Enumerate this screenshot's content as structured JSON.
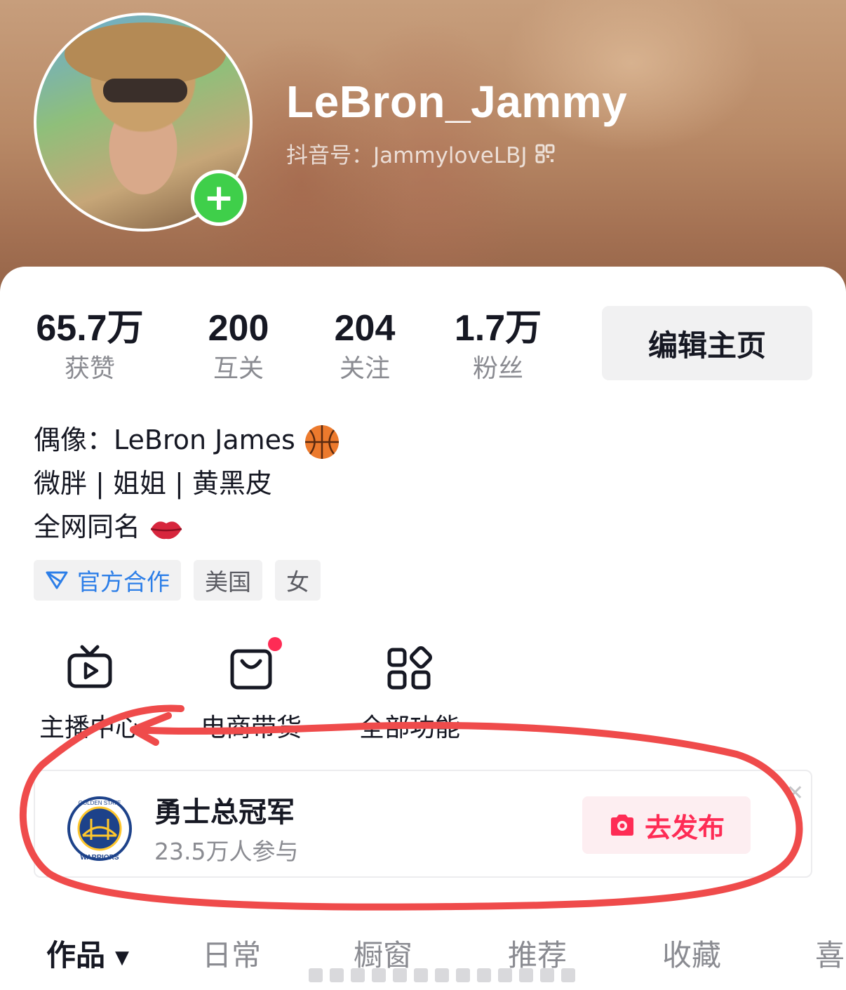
{
  "profile": {
    "username": "LeBron_Jammy",
    "douyin_id": "抖音号：JammyloveLBJ",
    "add_icon": "plus-icon",
    "qr_icon": "qr-code-icon"
  },
  "stats": [
    {
      "value": "65.7万",
      "label": "获赞"
    },
    {
      "value": "200",
      "label": "互关"
    },
    {
      "value": "204",
      "label": "关注"
    },
    {
      "value": "1.7万",
      "label": "粉丝"
    }
  ],
  "edit_button": "编辑主页",
  "bio": {
    "line1": "偶像：LeBron James",
    "line1_emoji": "basketball-icon",
    "line2": "微胖 | 姐姐 | 黄黑皮",
    "line3": "全网同名",
    "line3_emoji": "kiss-lips-icon"
  },
  "tags": [
    {
      "label": "官方合作",
      "icon": "cooperation-icon"
    },
    {
      "label": "美国"
    },
    {
      "label": "女"
    }
  ],
  "features": [
    {
      "label": "主播中心",
      "icon": "tv-play-icon"
    },
    {
      "label": "电商带货",
      "icon": "shopping-bag-icon",
      "has_dot": true
    },
    {
      "label": "全部功能",
      "icon": "grid-apps-icon"
    }
  ],
  "banner": {
    "title": "勇士总冠军",
    "subtitle": "23.5万人参与",
    "logo_text_top": "GOLDEN STATE",
    "logo_text_bottom": "WARRIORS",
    "publish_label": "去发布",
    "publish_icon": "camera-icon",
    "close_icon": "close-icon"
  },
  "tabs": [
    {
      "label": "作品",
      "active": true
    },
    {
      "label": "日常"
    },
    {
      "label": "橱窗"
    },
    {
      "label": "推荐"
    },
    {
      "label": "收藏"
    },
    {
      "label": "喜"
    }
  ],
  "colors": {
    "accent": "#fe2c55",
    "add_green": "#3fcf4a",
    "official_blue": "#2c7ee8",
    "annotation_red": "#ef4b4b"
  }
}
